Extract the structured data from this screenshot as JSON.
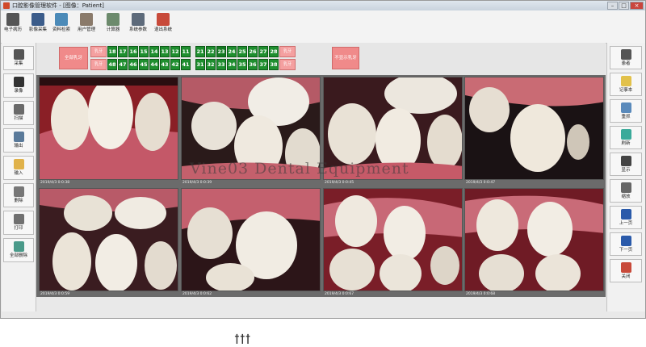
{
  "title": "口腔影像管理软件 - [图像：Patient]",
  "window_buttons": [
    "–",
    "□",
    "×"
  ],
  "toolbar": [
    {
      "label": "电子病历",
      "icon": "ehr-icon",
      "color": "#555555"
    },
    {
      "label": "影像采集",
      "icon": "capture-monitor-icon",
      "color": "#3b5c8a"
    },
    {
      "label": "资料检索",
      "icon": "search-globe-icon",
      "color": "#4b8ab8"
    },
    {
      "label": "用户管理",
      "icon": "user-tools-icon",
      "color": "#8a7a6a"
    },
    {
      "label": "计算器",
      "icon": "calculator-icon",
      "color": "#6c8a6c"
    },
    {
      "label": "系统参数",
      "icon": "settings-icon",
      "color": "#5d6a7a"
    },
    {
      "label": "退出系统",
      "icon": "exit-icon",
      "color": "#c84a3a"
    }
  ],
  "left_sidebar": [
    {
      "label": "采集",
      "icon": "camera-icon",
      "color": "#555555"
    },
    {
      "label": "录像",
      "icon": "video-camera-icon",
      "color": "#333333"
    },
    {
      "label": "扫描",
      "icon": "scanner-icon",
      "color": "#6a6a6a"
    },
    {
      "label": "输出",
      "icon": "output-icon",
      "color": "#5a7a9a"
    },
    {
      "label": "输入",
      "icon": "folder-icon",
      "color": "#e0b24a"
    },
    {
      "label": "删除",
      "icon": "delete-icon",
      "color": "#777777"
    },
    {
      "label": "打印",
      "icon": "print-icon",
      "color": "#707070"
    },
    {
      "label": "全部删除",
      "icon": "delete-all-icon",
      "color": "#4a9a8a"
    }
  ],
  "right_sidebar": [
    {
      "label": "患者",
      "icon": "patient-icon",
      "color": "#555555"
    },
    {
      "label": "记事本",
      "icon": "notepad-icon",
      "color": "#e2c14a"
    },
    {
      "label": "重抓",
      "icon": "recapture-icon",
      "color": "#5a8abb"
    },
    {
      "label": "刷新",
      "icon": "refresh-icon",
      "color": "#3aaa9a"
    },
    {
      "label": "显示",
      "icon": "display-grid-icon",
      "color": "#444444"
    },
    {
      "label": "缩放",
      "icon": "zoom-icon",
      "color": "#666666"
    },
    {
      "label": "上一页",
      "icon": "arrow-up-icon",
      "color": "#2a5aaa"
    },
    {
      "label": "下一页",
      "icon": "arrow-down-icon",
      "color": "#2a5aaa"
    },
    {
      "label": "关闭",
      "icon": "close-window-icon",
      "color": "#c84a3a"
    }
  ],
  "dental_chart": {
    "left_pill": "全部乳牙",
    "right_pill": "不显示乳牙",
    "upper_right": [
      18,
      17,
      16,
      15,
      14,
      13,
      12,
      11
    ],
    "upper_left": [
      21,
      22,
      23,
      24,
      25,
      26,
      27,
      28
    ],
    "lower_right": [
      48,
      47,
      46,
      45,
      44,
      43,
      42,
      41
    ],
    "lower_left": [
      31,
      32,
      33,
      34,
      35,
      36,
      37,
      38
    ],
    "upper_deciduous_right": "乳牙",
    "upper_deciduous_left": "乳牙",
    "lower_deciduous_right": "乳牙",
    "lower_deciduous_left": "乳牙",
    "selected_tooth": 23
  },
  "images": [
    {
      "caption": "2019/4/3 0:0:38"
    },
    {
      "caption": "2019/4/3 0:0:39"
    },
    {
      "caption": "2019/4/3 0:0:45"
    },
    {
      "caption": "2019/4/3 0:0:47"
    },
    {
      "caption": "2019/4/3 0:0:59"
    },
    {
      "caption": "2019/4/3 0:0:62"
    },
    {
      "caption": "2019/4/3 0:0:67"
    },
    {
      "caption": "2019/4/3 0:0:68"
    }
  ],
  "watermark": "Vine03 Dental Equipment",
  "handwriting": "ꝉꝉꝉ"
}
